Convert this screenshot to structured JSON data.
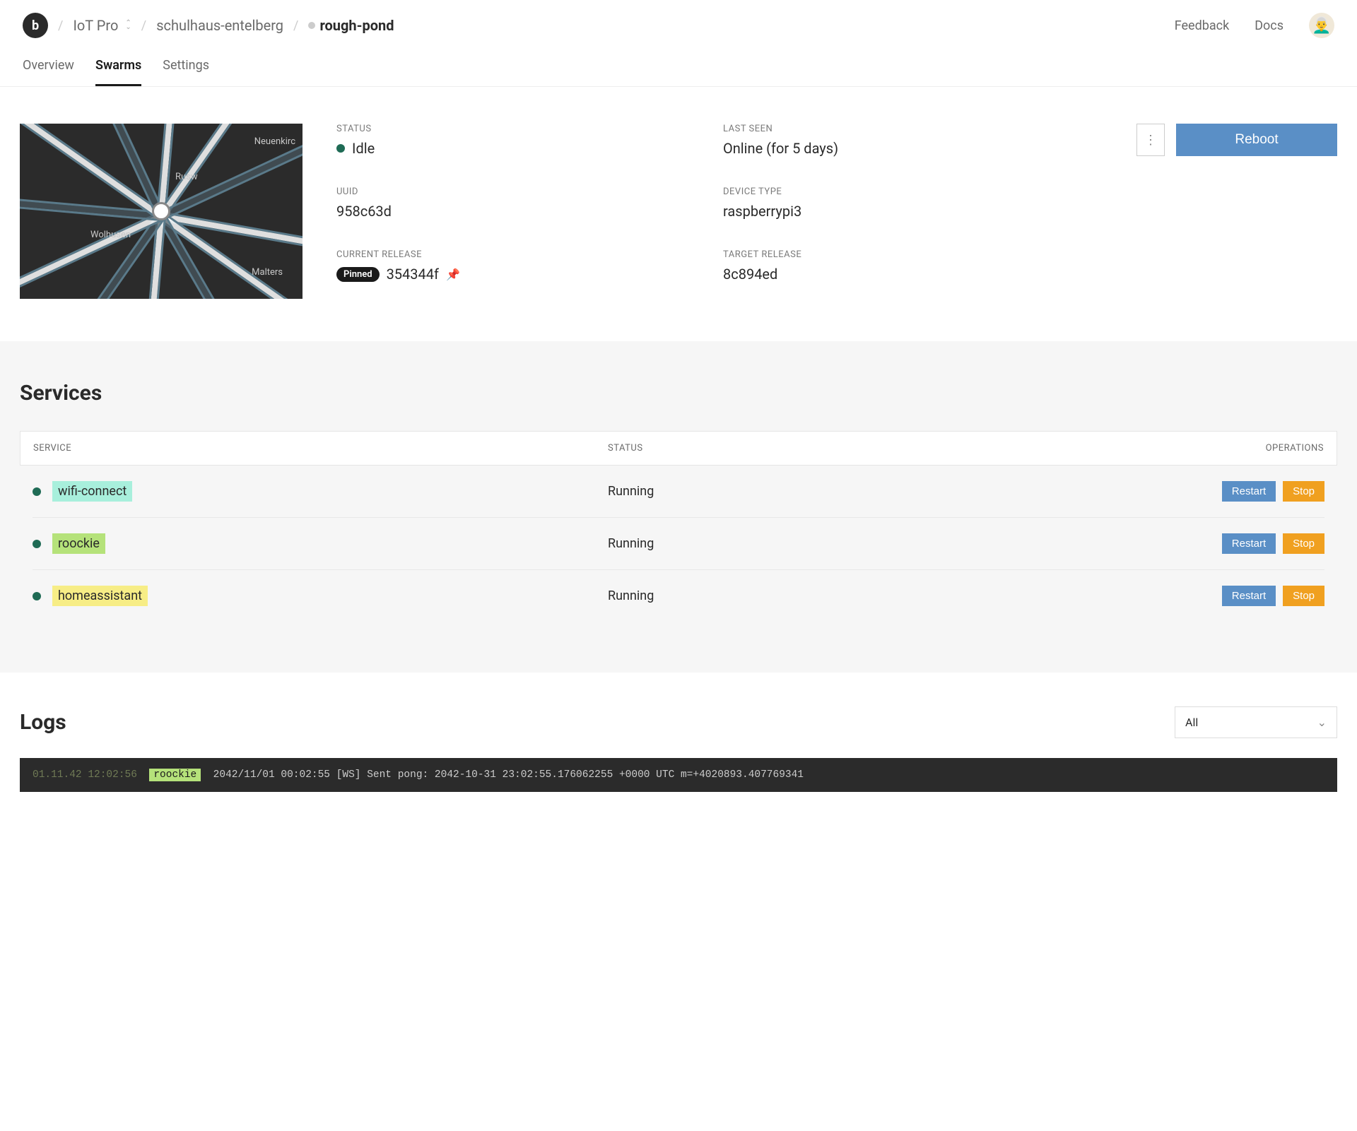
{
  "header": {
    "logo_letter": "b",
    "breadcrumbs": {
      "org": "IoT Pro",
      "project": "schulhaus-entelberg",
      "device": "rough-pond"
    },
    "links": {
      "feedback": "Feedback",
      "docs": "Docs"
    },
    "avatar_emoji": "👨‍🦳"
  },
  "tabs": {
    "overview": "Overview",
    "swarms": "Swarms",
    "settings": "Settings",
    "active": "swarms"
  },
  "map": {
    "labels": [
      "Neuenkirc",
      "Rusw",
      "Wolhusen",
      "Malters"
    ]
  },
  "device": {
    "status_label": "STATUS",
    "status_value": "Idle",
    "last_seen_label": "LAST SEEN",
    "last_seen_value": "Online (for 5 days)",
    "uuid_label": "UUID",
    "uuid_value": "958c63d",
    "device_type_label": "DEVICE TYPE",
    "device_type_value": "raspberrypi3",
    "current_release_label": "CURRENT RELEASE",
    "current_release_badge": "Pinned",
    "current_release_value": "354344f",
    "target_release_label": "TARGET RELEASE",
    "target_release_value": "8c894ed"
  },
  "actions": {
    "reboot": "Reboot"
  },
  "services": {
    "title": "Services",
    "columns": {
      "service": "SERVICE",
      "status": "STATUS",
      "operations": "OPERATIONS"
    },
    "rows": [
      {
        "name": "wifi-connect",
        "status": "Running",
        "color": "#a8efdc"
      },
      {
        "name": "roockie",
        "status": "Running",
        "color": "#b5e27a"
      },
      {
        "name": "homeassistant",
        "status": "Running",
        "color": "#f7ed86"
      }
    ],
    "buttons": {
      "restart": "Restart",
      "stop": "Stop"
    }
  },
  "logs": {
    "title": "Logs",
    "filter_selected": "All",
    "entry": {
      "ts": "01.11.42 12:02:56",
      "tag": "roockie",
      "msg": "2042/11/01 00:02:55 [WS] Sent pong: 2042-10-31 23:02:55.176062255 +0000 UTC m=+4020893.407769341"
    }
  }
}
